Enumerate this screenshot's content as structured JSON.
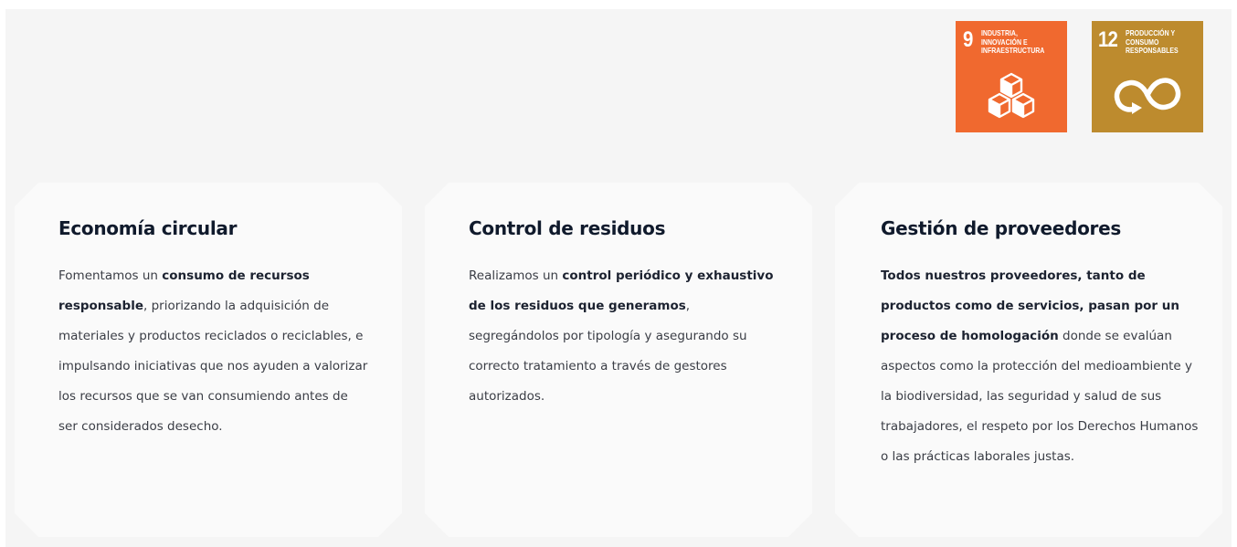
{
  "colors": {
    "sdg9": "#f0692f",
    "sdg12": "#bd8b2e"
  },
  "badges": [
    {
      "number": "9",
      "title": "INDUSTRIA, INNOVACIÓN E INFRAESTRUCTURA",
      "icon": "cubes-icon"
    },
    {
      "number": "12",
      "title": "PRODUCCIÓN Y CONSUMO RESPONSABLES",
      "icon": "infinity-loop-icon"
    }
  ],
  "cards": [
    {
      "title": "Economía circular",
      "segments": [
        {
          "text": "Fomentamos un ",
          "bold": false
        },
        {
          "text": "consumo de recursos responsable",
          "bold": true
        },
        {
          "text": ", priorizando la adquisición de materiales y productos reciclados o reciclables, e impulsando iniciativas que nos ayuden a valorizar los recursos que se van consumiendo antes de ser considerados desecho.",
          "bold": false
        }
      ]
    },
    {
      "title": "Control de residuos",
      "segments": [
        {
          "text": "Realizamos un ",
          "bold": false
        },
        {
          "text": "control periódico y exhaustivo de los residuos que generamos",
          "bold": true
        },
        {
          "text": ", segregándolos por tipología y asegurando su correcto tratamiento a través de gestores autorizados.",
          "bold": false
        }
      ]
    },
    {
      "title": "Gestión de proveedores",
      "segments": [
        {
          "text": "Todos nuestros proveedores, tanto de productos como de servicios, pasan por un proceso de homologación",
          "bold": true
        },
        {
          "text": " donde se evalúan aspectos como la protección del medioambiente y la biodiversidad, las seguridad y salud de sus trabajadores, el respeto por los Derechos Humanos o las prácticas laborales justas.",
          "bold": false
        }
      ]
    }
  ]
}
